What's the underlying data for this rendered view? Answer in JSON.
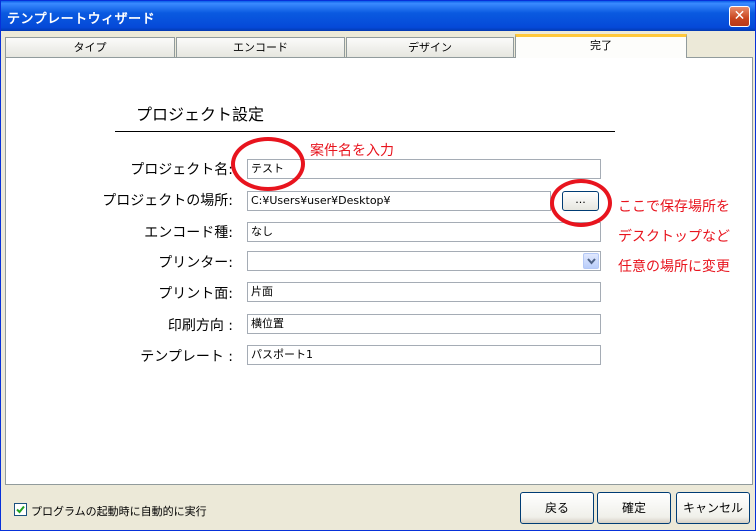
{
  "window": {
    "title": "テンプレートウィザード",
    "close_glyph": "✕"
  },
  "tabs": [
    {
      "label": "タイプ"
    },
    {
      "label": "エンコード"
    },
    {
      "label": "デザイン"
    },
    {
      "label": "完了",
      "active": true
    }
  ],
  "section": {
    "title": "プロジェクト設定"
  },
  "fields": {
    "project_name": {
      "label": "プロジェクト名:",
      "value": "テスト"
    },
    "location": {
      "label": "プロジェクトの場所:",
      "value": "C:¥Users¥user¥Desktop¥",
      "browse_label": "..."
    },
    "encoding": {
      "label": "エンコード種:",
      "value": "なし"
    },
    "printer": {
      "label": "プリンター:",
      "value": ""
    },
    "print_side": {
      "label": "プリント面:",
      "value": "片面"
    },
    "print_direction": {
      "label": "印刷方向 :",
      "value": "横位置"
    },
    "template": {
      "label": "テンプレート :",
      "value": "パスポート1"
    }
  },
  "annotations": {
    "name_hint": "案件名を入力",
    "location_hint_line1": "ここで保存場所を",
    "location_hint_line2": "デスクトップなど",
    "location_hint_line3": "任意の場所に変更",
    "color": "#e8141e"
  },
  "footer": {
    "auto_run_label": "プログラムの起動時に自動的に実行",
    "auto_run_checked": true,
    "back_label": "戻る",
    "ok_label": "確定",
    "cancel_label": "キャンセル"
  }
}
